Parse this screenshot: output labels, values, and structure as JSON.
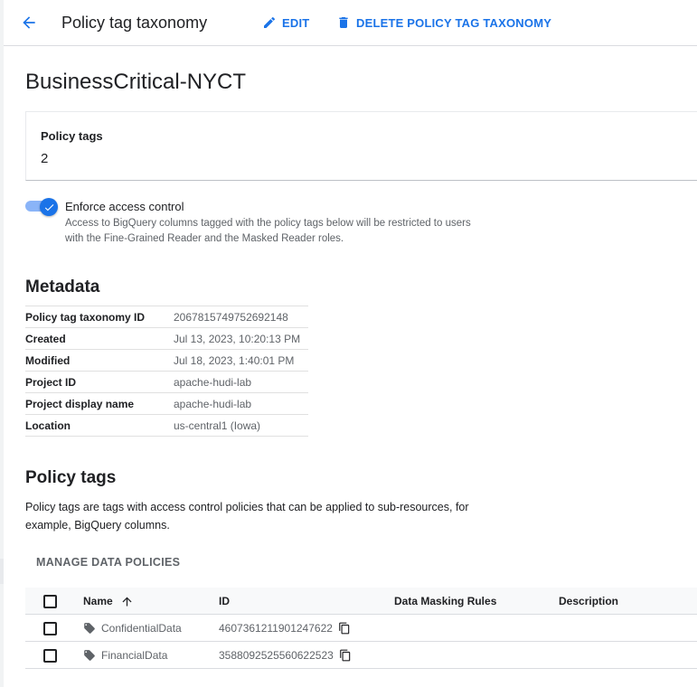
{
  "header": {
    "title": "Policy tag taxonomy",
    "edit_label": "EDIT",
    "delete_label": "DELETE POLICY TAG TAXONOMY"
  },
  "taxonomy": {
    "name": "BusinessCritical-NYCT",
    "policy_tags_label": "Policy tags",
    "policy_tags_count": "2"
  },
  "access_control": {
    "enabled": true,
    "label": "Enforce access control",
    "description": "Access to BigQuery columns tagged with the policy tags below will be restricted to users with the Fine-Grained Reader and the Masked Reader roles."
  },
  "metadata": {
    "title": "Metadata",
    "rows": [
      {
        "key": "Policy tag taxonomy ID",
        "value": "2067815749752692148"
      },
      {
        "key": "Created",
        "value": "Jul 13, 2023, 10:20:13 PM"
      },
      {
        "key": "Modified",
        "value": "Jul 18, 2023, 1:40:01 PM"
      },
      {
        "key": "Project ID",
        "value": "apache-hudi-lab"
      },
      {
        "key": "Project display name",
        "value": "apache-hudi-lab"
      },
      {
        "key": "Location",
        "value": "us-central1 (Iowa)"
      }
    ]
  },
  "policy_tags": {
    "title": "Policy tags",
    "description": "Policy tags are tags with access control policies that can be applied to sub-resources, for example, BigQuery columns.",
    "manage_label": "MANAGE DATA POLICIES",
    "columns": {
      "name": "Name",
      "id": "ID",
      "masking": "Data Masking Rules",
      "description": "Description"
    },
    "rows": [
      {
        "name": "ConfidentialData",
        "id": "4607361211901247622",
        "masking": "",
        "description": ""
      },
      {
        "name": "FinancialData",
        "id": "3588092525560622523",
        "masking": "",
        "description": ""
      }
    ]
  },
  "colors": {
    "accent": "#1a73e8",
    "toggle_track": "#8ab4f8",
    "text_primary": "#202124",
    "text_secondary": "#5f6368",
    "divider": "#dadce0"
  },
  "icons": [
    "arrow-back-icon",
    "edit-pencil-icon",
    "trash-icon",
    "check-icon",
    "arrow-up-icon",
    "tag-icon",
    "copy-icon"
  ]
}
